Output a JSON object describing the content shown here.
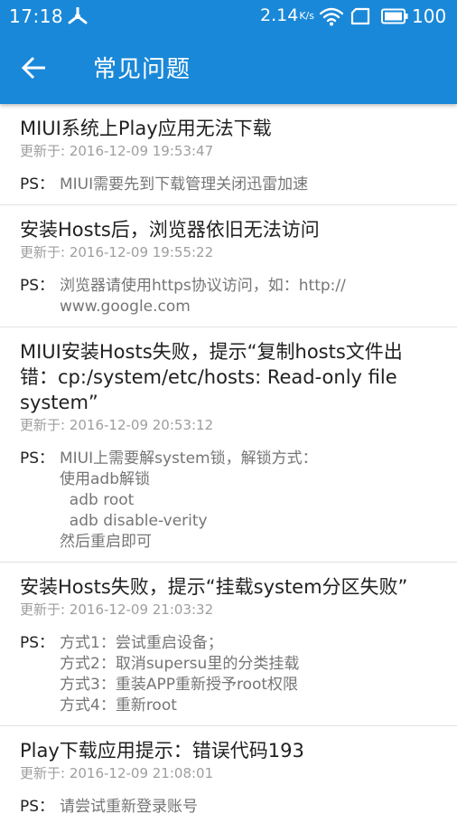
{
  "status_bar": {
    "time": "17:18",
    "net_speed": "2.14",
    "net_speed_unit": "K/s",
    "battery_level": "100"
  },
  "toolbar": {
    "title": "常见问题"
  },
  "faq": [
    {
      "title": "MIUI系统上Play应用无法下载",
      "date": "更新于: 2016-12-09 19:53:47",
      "ps_label": "PS：",
      "lines": [
        "MIUI需要先到下载管理关闭迅雷加速"
      ]
    },
    {
      "title": "安装Hosts后，浏览器依旧无法访问",
      "date": "更新于: 2016-12-09 19:55:22",
      "ps_label": "PS：",
      "lines": [
        "浏览器请使用https协议访问，如：http://",
        "www.google.com"
      ]
    },
    {
      "title": "MIUI安装Hosts失败，提示“复制hosts文件出错：cp:/system/etc/hosts: Read-only file system”",
      "date": "更新于: 2016-12-09 20:53:12",
      "ps_label": "PS：",
      "lines": [
        "MIUI上需要解system锁，解锁方式：",
        "使用adb解锁",
        "  adb root",
        "  adb disable-verity",
        "然后重启即可"
      ]
    },
    {
      "title": "安装Hosts失败，提示“挂载system分区失败”",
      "date": "更新于: 2016-12-09 21:03:32",
      "ps_label": "PS：",
      "lines": [
        "方式1：尝试重启设备；",
        "方式2：取消supersu里的分类挂载",
        "方式3：重装APP重新授予root权限",
        "方式4：重新root"
      ]
    },
    {
      "title": "Play下载应用提示：错误代码193",
      "date": "更新于: 2016-12-09 21:08:01",
      "ps_label": "PS：",
      "lines": [
        "请尝试重新登录账号"
      ]
    }
  ]
}
